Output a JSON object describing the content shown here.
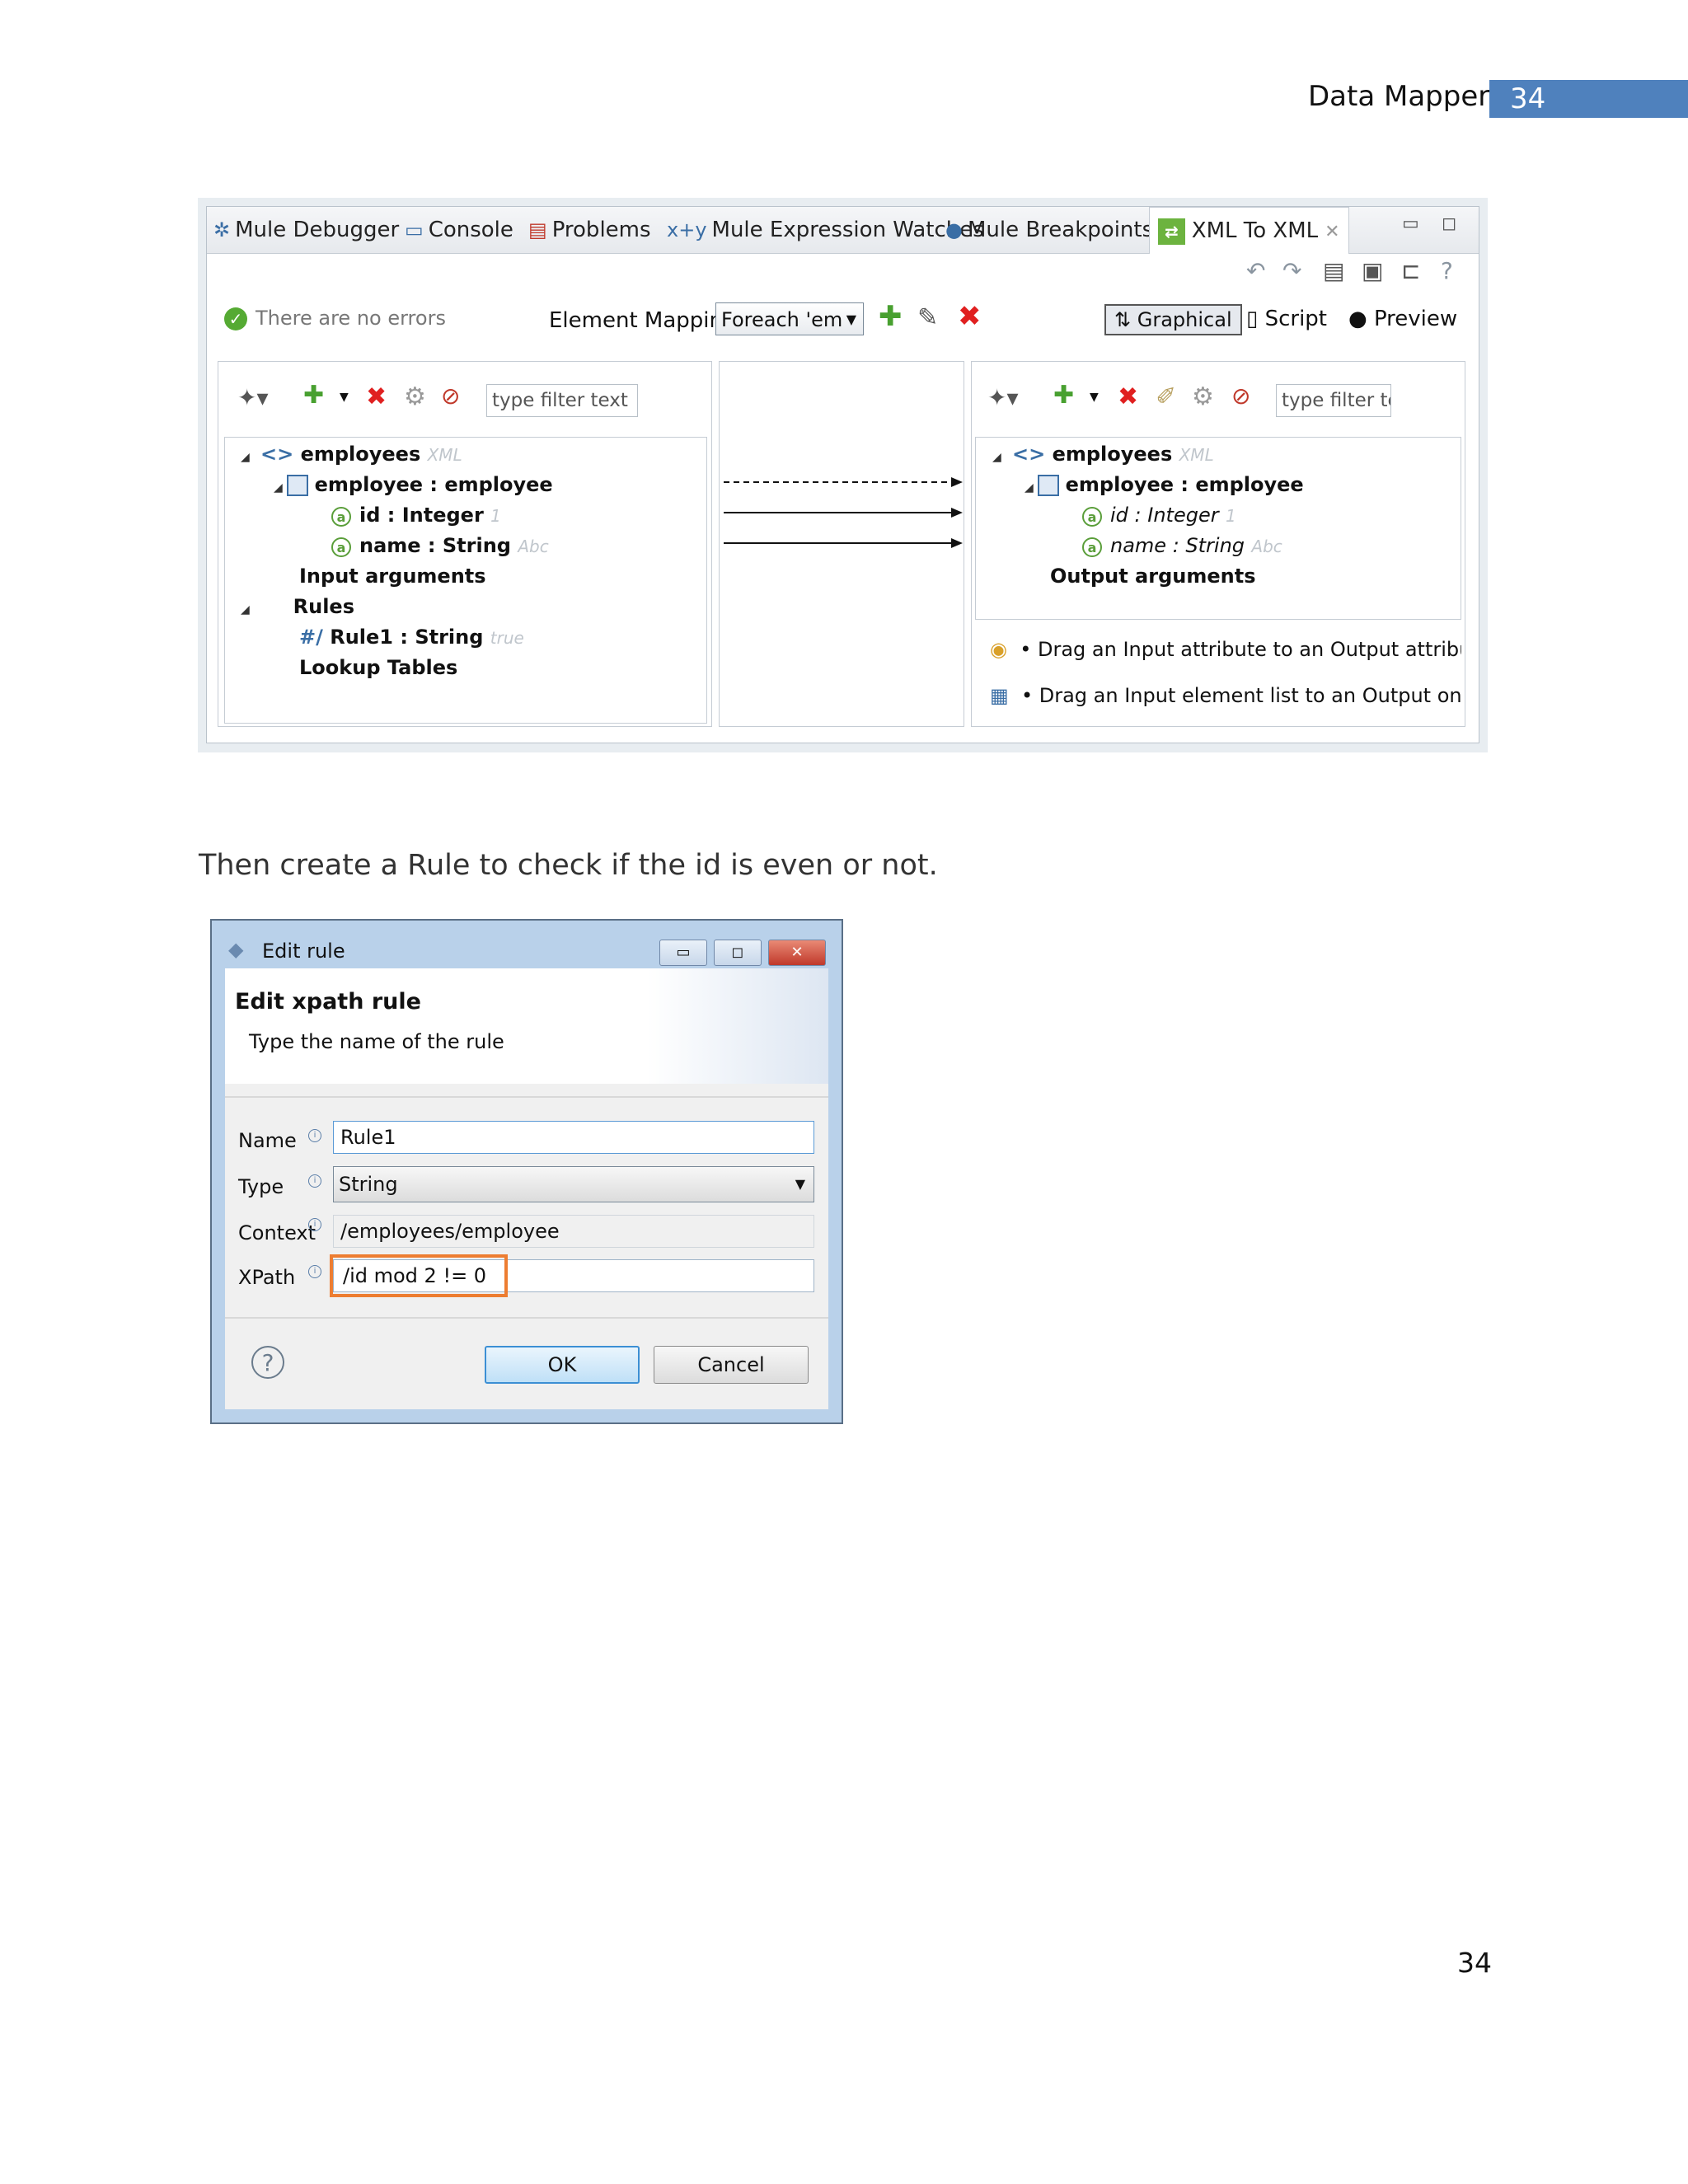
{
  "header": {
    "title": "Data Mapper",
    "page": "34"
  },
  "screenshot1": {
    "tabs": [
      {
        "label": "Mule Debugger",
        "icon": "bug-icon"
      },
      {
        "label": "Console",
        "icon": "console-icon"
      },
      {
        "label": "Problems",
        "icon": "problems-icon"
      },
      {
        "label": "Mule Expression Watches",
        "icon": "watch-icon"
      },
      {
        "label": "Mule Breakpoints",
        "icon": "breakpoints-icon"
      },
      {
        "label": "XML To XML",
        "icon": "xml-icon",
        "active": true
      }
    ],
    "status": "There are no errors",
    "element_mapping_label": "Element Mapping",
    "element_mapping_value": "Foreach 'em",
    "view_modes": [
      "Graphical",
      "Script",
      "Preview"
    ],
    "left_filter_placeholder": "type filter text",
    "right_filter_placeholder": "type filter te",
    "left_tree": {
      "root": "employees",
      "root_type": "XML",
      "element": "employee : employee",
      "attr1": "id : Integer",
      "attr1_sample": "1",
      "attr2": "name : String",
      "attr2_sample": "Abc",
      "input_args": "Input arguments",
      "rules": "Rules",
      "rule1": "Rule1 : String",
      "rule1_sample": "true",
      "lookup": "Lookup Tables"
    },
    "right_tree": {
      "root": "employees",
      "root_type": "XML",
      "element": "employee : employee",
      "attr1": "id : Integer",
      "attr1_sample": "1",
      "attr2": "name : String",
      "attr2_sample": "Abc",
      "output_args": "Output arguments"
    },
    "hints": [
      "• Drag an Input attribute to an Output attribute to",
      "• Drag an Input element list to an Output one to r"
    ]
  },
  "paragraph": "Then create a Rule to check if the id is even or not.",
  "dialog": {
    "title": "Edit rule",
    "heading": "Edit xpath rule",
    "subheading": "Type the name of the rule",
    "fields": {
      "name_label": "Name",
      "name_value": "Rule1",
      "type_label": "Type",
      "type_value": "String",
      "context_label": "Context",
      "context_value": "/employees/employee",
      "xpath_label": "XPath",
      "xpath_value": "/id mod 2 != 0"
    },
    "ok": "OK",
    "cancel": "Cancel",
    "highlight_color": "#ed7d31"
  },
  "footer_page": "34"
}
